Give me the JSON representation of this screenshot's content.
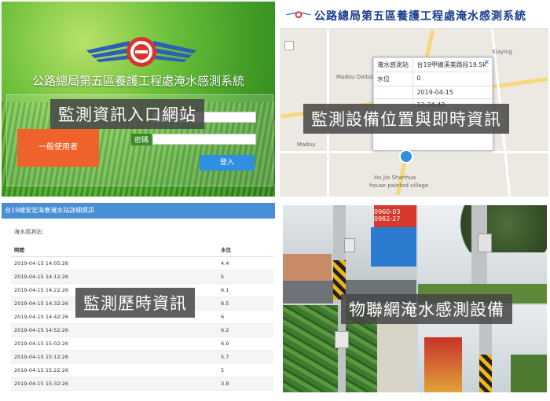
{
  "login_panel": {
    "system_title": "公路總局第五區養護工程處淹水感測系統",
    "password_label": "密碼",
    "general_user_button": "一般使用者",
    "login_button": "登入",
    "caption": "監測資訊入口網站"
  },
  "map_panel": {
    "header_title": "公路總局第五區養護工程處淹水感測系統",
    "popup": {
      "rows": [
        {
          "key": "淹水感測站",
          "value": "台19甲線溪美路段19.5k"
        },
        {
          "key": "水位",
          "value": "0"
        },
        {
          "key": "",
          "value": "2019-04-15"
        },
        {
          "key": "",
          "value": "13:34:42"
        }
      ]
    },
    "labels": [
      "Madou Daitian",
      "Hu Jia Shanhua",
      "house painted village",
      "Madou",
      "Xiaying"
    ],
    "caption": "監測設備位置與即時資訊"
  },
  "history_panel": {
    "header": "台19線安定海寮淹水站詳細資訊",
    "sub_label": "淹水感測站：",
    "columns": [
      "時間",
      "水位"
    ],
    "rows": [
      [
        "2019-04-15 14:05:26",
        "4.4"
      ],
      [
        "2019-04-15 14:12:26",
        "5"
      ],
      [
        "2019-04-15 14:22:26",
        "6.1"
      ],
      [
        "2019-04-15 14:32:26",
        "6.5"
      ],
      [
        "2019-04-15 14:42:26",
        "6"
      ],
      [
        "2019-04-15 14:52:26",
        "6.2"
      ],
      [
        "2019-04-15 15:02:26",
        "6.9"
      ],
      [
        "2019-04-15 15:12:26",
        "5.7"
      ],
      [
        "2019-04-15 15:22:26",
        "5"
      ],
      [
        "2019-04-15 15:32:26",
        "3.8"
      ]
    ],
    "caption": "監測歷時資訊"
  },
  "photo_panel": {
    "sign_text": "0960-03\n0982-27",
    "caption": "物聯網淹水感測設備"
  },
  "colors": {
    "caption_bg": "#464646",
    "header_blue": "#4a8fd6",
    "orange_button": "#f0622b",
    "login_blue": "#2f8fe0"
  }
}
